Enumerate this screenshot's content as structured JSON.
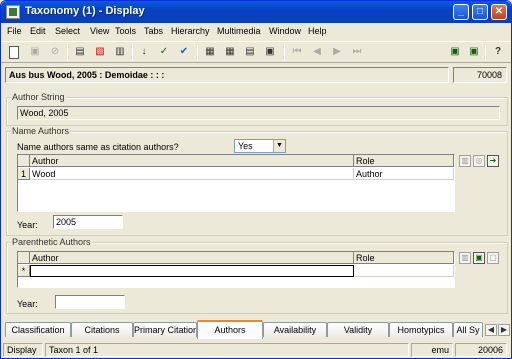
{
  "window": {
    "title": "Taxonomy (1) - Display",
    "buttons": {
      "minimize": "_",
      "maximize": "□",
      "close": "✕"
    }
  },
  "menu": [
    "File",
    "Edit",
    "Select",
    "View",
    "Tools",
    "Tabs",
    "Hierarchy",
    "Multimedia",
    "Window",
    "Help"
  ],
  "toolbar": {
    "icons": [
      "new-document-icon",
      "save-icon",
      "disabled-icon",
      "view-record-icon",
      "delete-record-icon",
      "attach-icon",
      "sort-icon",
      "edit-check-icon",
      "spell-check-icon",
      "list-view-icon",
      "table-view-icon",
      "page-view-icon",
      "print-preview-icon",
      "first-record-icon",
      "previous-record-icon",
      "next-record-icon",
      "last-record-icon",
      "report-icon",
      "export-icon",
      "help-pointer-icon"
    ]
  },
  "record": {
    "summary": "Aus bus Wood, 2005 : Demoidae : : :",
    "number": "70008"
  },
  "author_string": {
    "label": "Author String",
    "value": "Wood, 2005"
  },
  "name_authors": {
    "label": "Name Authors",
    "same_question": "Name authors same as citation authors?",
    "same_value": "Yes",
    "columns": [
      "Author",
      "Role"
    ],
    "rows": [
      {
        "index": "1",
        "author": "Wood",
        "role": "Author"
      }
    ],
    "year_label": "Year:",
    "year_value": "2005"
  },
  "parenthetic_authors": {
    "label": "Parenthetic Authors",
    "columns": [
      "Author",
      "Role"
    ],
    "new_row_marker": "*",
    "year_label": "Year:",
    "year_value": ""
  },
  "tabs": [
    "Classification",
    "Citations",
    "Primary Citation",
    "Authors",
    "Availability",
    "Validity",
    "Homotypics",
    "All Sy"
  ],
  "active_tab": "Authors",
  "status": {
    "mode": "Display",
    "position": "Taxon 1 of 1",
    "app": "emu",
    "record": "20006"
  },
  "colors": {
    "titlebar": "#0a4ac8",
    "tab_highlight": "#e68b2c"
  }
}
